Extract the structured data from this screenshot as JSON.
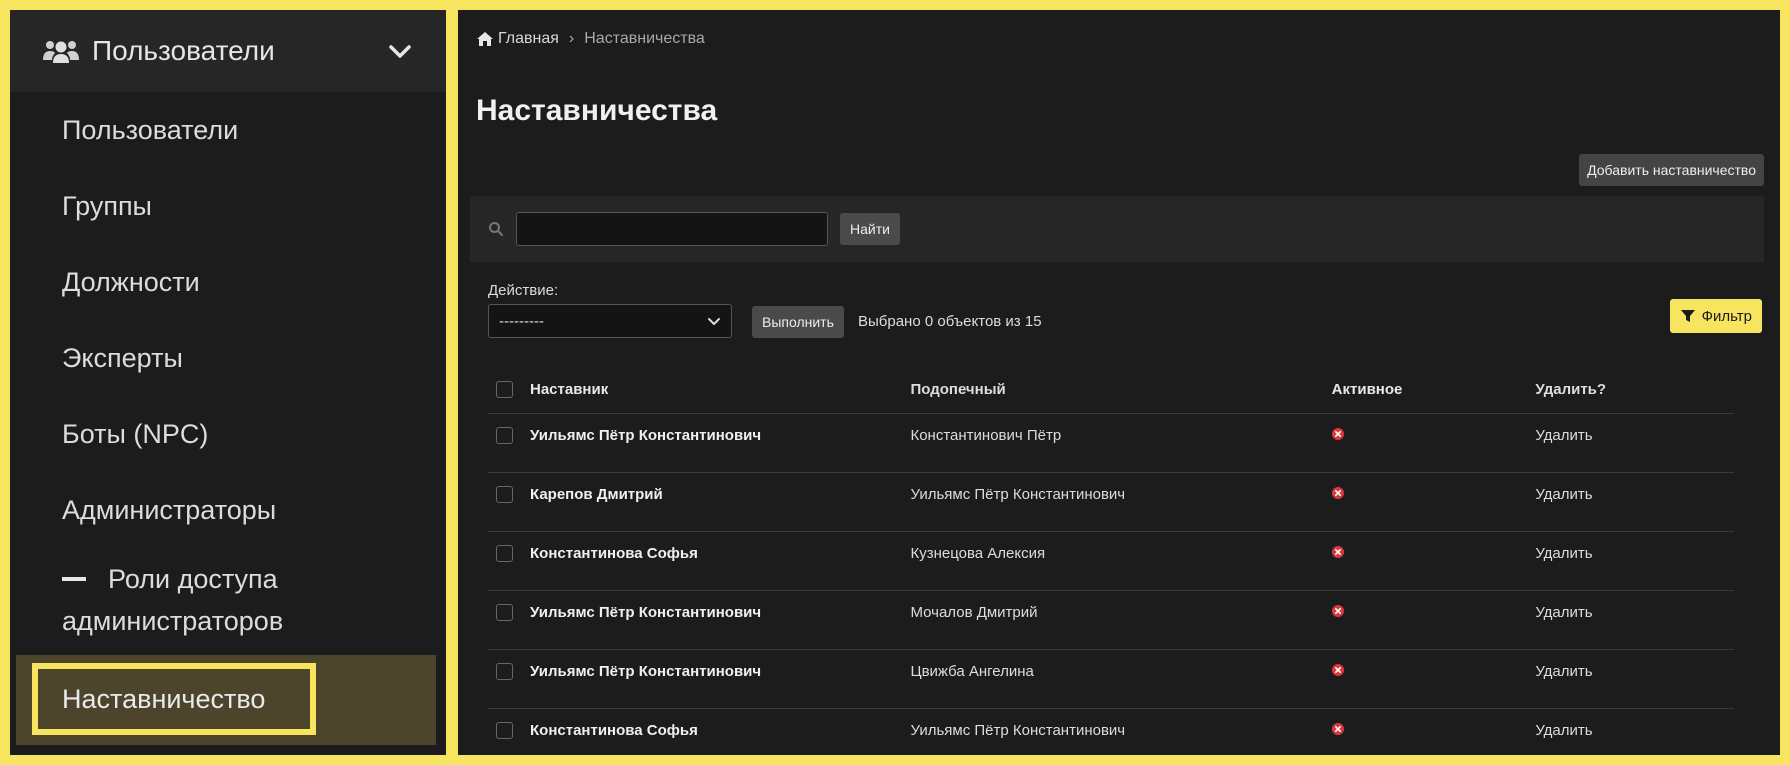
{
  "sidebar": {
    "header_title": "Пользователи",
    "items": [
      {
        "label": "Пользователи"
      },
      {
        "label": "Группы"
      },
      {
        "label": "Должности"
      },
      {
        "label": "Эксперты"
      },
      {
        "label": "Боты (NPC)"
      },
      {
        "label": "Администраторы"
      }
    ],
    "roles_line1": "Роли доступа",
    "roles_line2": "администраторов",
    "active_item": "Наставничество"
  },
  "breadcrumb": {
    "home": "Главная",
    "separator": "›",
    "current": "Наставничества"
  },
  "page_title": "Наставничества",
  "add_button": "Добавить наставничество",
  "search": {
    "value": "",
    "placeholder": "",
    "button": "Найти"
  },
  "actions": {
    "label": "Действие:",
    "selected_option": "---------",
    "run_button": "Выполнить",
    "selected_text": "Выбрано 0 объектов из 15"
  },
  "filter_button": "Фильтр",
  "table": {
    "headers": {
      "mentor": "Наставник",
      "mentee": "Подопечный",
      "active": "Активное",
      "delete": "Удалить?"
    },
    "rows": [
      {
        "mentor": "Уильямс Пётр Константинович",
        "mentee": "Константинович Пётр",
        "active": false,
        "delete": "Удалить"
      },
      {
        "mentor": "Карепов Дмитрий",
        "mentee": "Уильямс Пётр Константинович",
        "active": false,
        "delete": "Удалить"
      },
      {
        "mentor": "Константинова Софья",
        "mentee": "Кузнецова Алексия",
        "active": false,
        "delete": "Удалить"
      },
      {
        "mentor": "Уильямс Пётр Константинович",
        "mentee": "Мочалов Дмитрий",
        "active": false,
        "delete": "Удалить"
      },
      {
        "mentor": "Уильямс Пётр Константинович",
        "mentee": "Цвижба Ангелина",
        "active": false,
        "delete": "Удалить"
      },
      {
        "mentor": "Константинова Софья",
        "mentee": "Уильямс Пётр Константинович",
        "active": false,
        "delete": "Удалить"
      }
    ]
  },
  "colors": {
    "accent": "#f7e45f",
    "inactive_red": "#d9393e",
    "background": "#1c1c1c"
  }
}
